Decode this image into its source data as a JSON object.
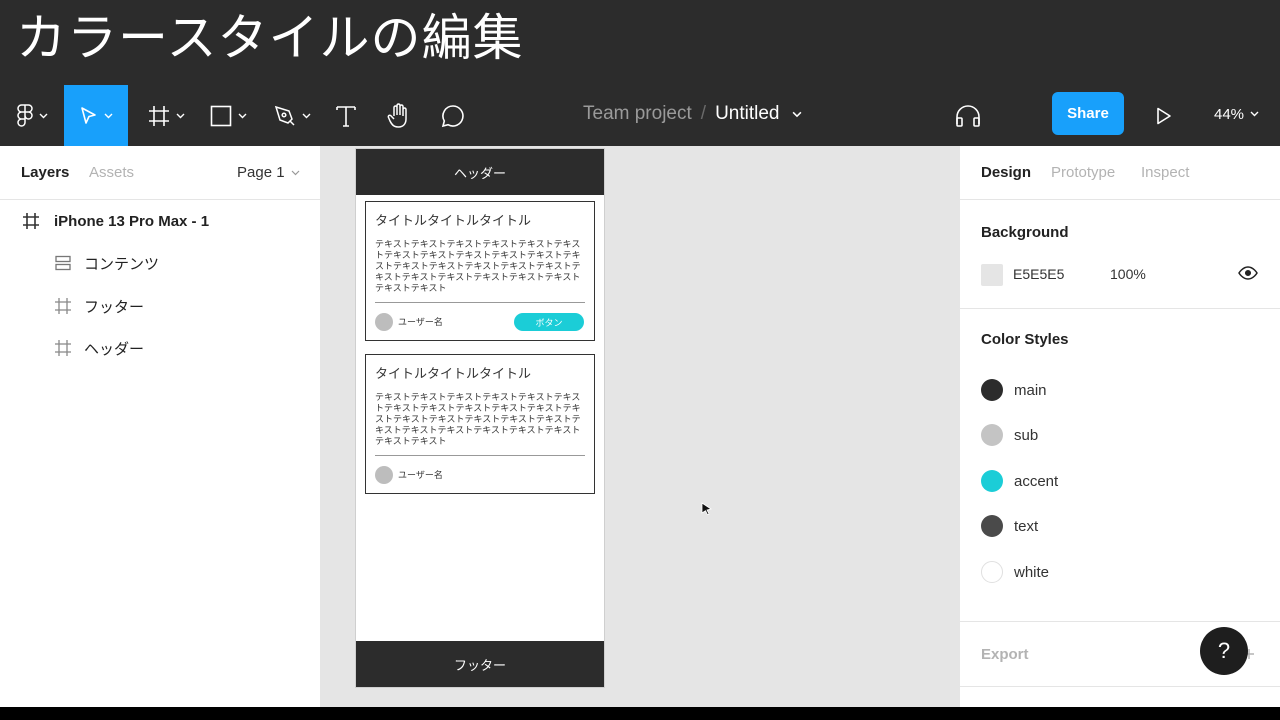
{
  "banner": {
    "title": "カラースタイルの編集"
  },
  "toolbar": {
    "tools": [
      {
        "icon": "figma-menu-icon"
      },
      {
        "icon": "move-tool-icon"
      },
      {
        "icon": "frame-tool-icon"
      },
      {
        "icon": "shape-tool-icon"
      },
      {
        "icon": "pen-tool-icon"
      },
      {
        "icon": "text-tool-icon"
      },
      {
        "icon": "hand-tool-icon"
      },
      {
        "icon": "comment-tool-icon"
      }
    ],
    "breadcrumb": {
      "team": "Team project",
      "separator": "/",
      "file": "Untitled"
    },
    "share_label": "Share",
    "zoom": "44%",
    "accent": "#18A0FB"
  },
  "left_panel": {
    "tabs": [
      "Layers",
      "Assets"
    ],
    "page": "Page 1",
    "layers": [
      {
        "name": "iPhone 13 Pro Max - 1",
        "icon": "frame-icon"
      },
      {
        "name": "コンテンツ",
        "icon": "auto-layout-icon"
      },
      {
        "name": "フッター",
        "icon": "frame-icon"
      },
      {
        "name": "ヘッダー",
        "icon": "frame-icon"
      }
    ]
  },
  "canvas": {
    "header_text": "ヘッダー",
    "footer_text": "フッター",
    "cards": [
      {
        "title": "タイトルタイトルタイトル",
        "body": "テキストテキストテキストテキストテキストテキストテキストテキストテキストテキストテキストテキストテキストテキストテキストテキストテキストテキストテキストテキストテキストテキストテキストテキストテキスト",
        "user": "ユーザー名",
        "button": "ボタン"
      },
      {
        "title": "タイトルタイトルタイトル",
        "body": "テキストテキストテキストテキストテキストテキストテキストテキストテキストテキストテキストテキストテキストテキストテキストテキストテキストテキストテキストテキストテキストテキストテキストテキストテキスト",
        "user": "ユーザー名"
      }
    ]
  },
  "right_panel": {
    "tabs": [
      "Design",
      "Prototype",
      "Inspect"
    ],
    "background": {
      "title": "Background",
      "hex": "E5E5E5",
      "opacity": "100%",
      "color": "#E5E5E5"
    },
    "color_styles": {
      "title": "Color Styles",
      "items": [
        {
          "name": "main",
          "color": "#2C2C2C"
        },
        {
          "name": "sub",
          "color": "#C4C4C4"
        },
        {
          "name": "accent",
          "color": "#1BCDD7"
        },
        {
          "name": "text",
          "color": "#4A4A4A"
        },
        {
          "name": "white",
          "color": "#FFFFFF"
        }
      ]
    },
    "export_label": "Export",
    "help_label": "?"
  }
}
